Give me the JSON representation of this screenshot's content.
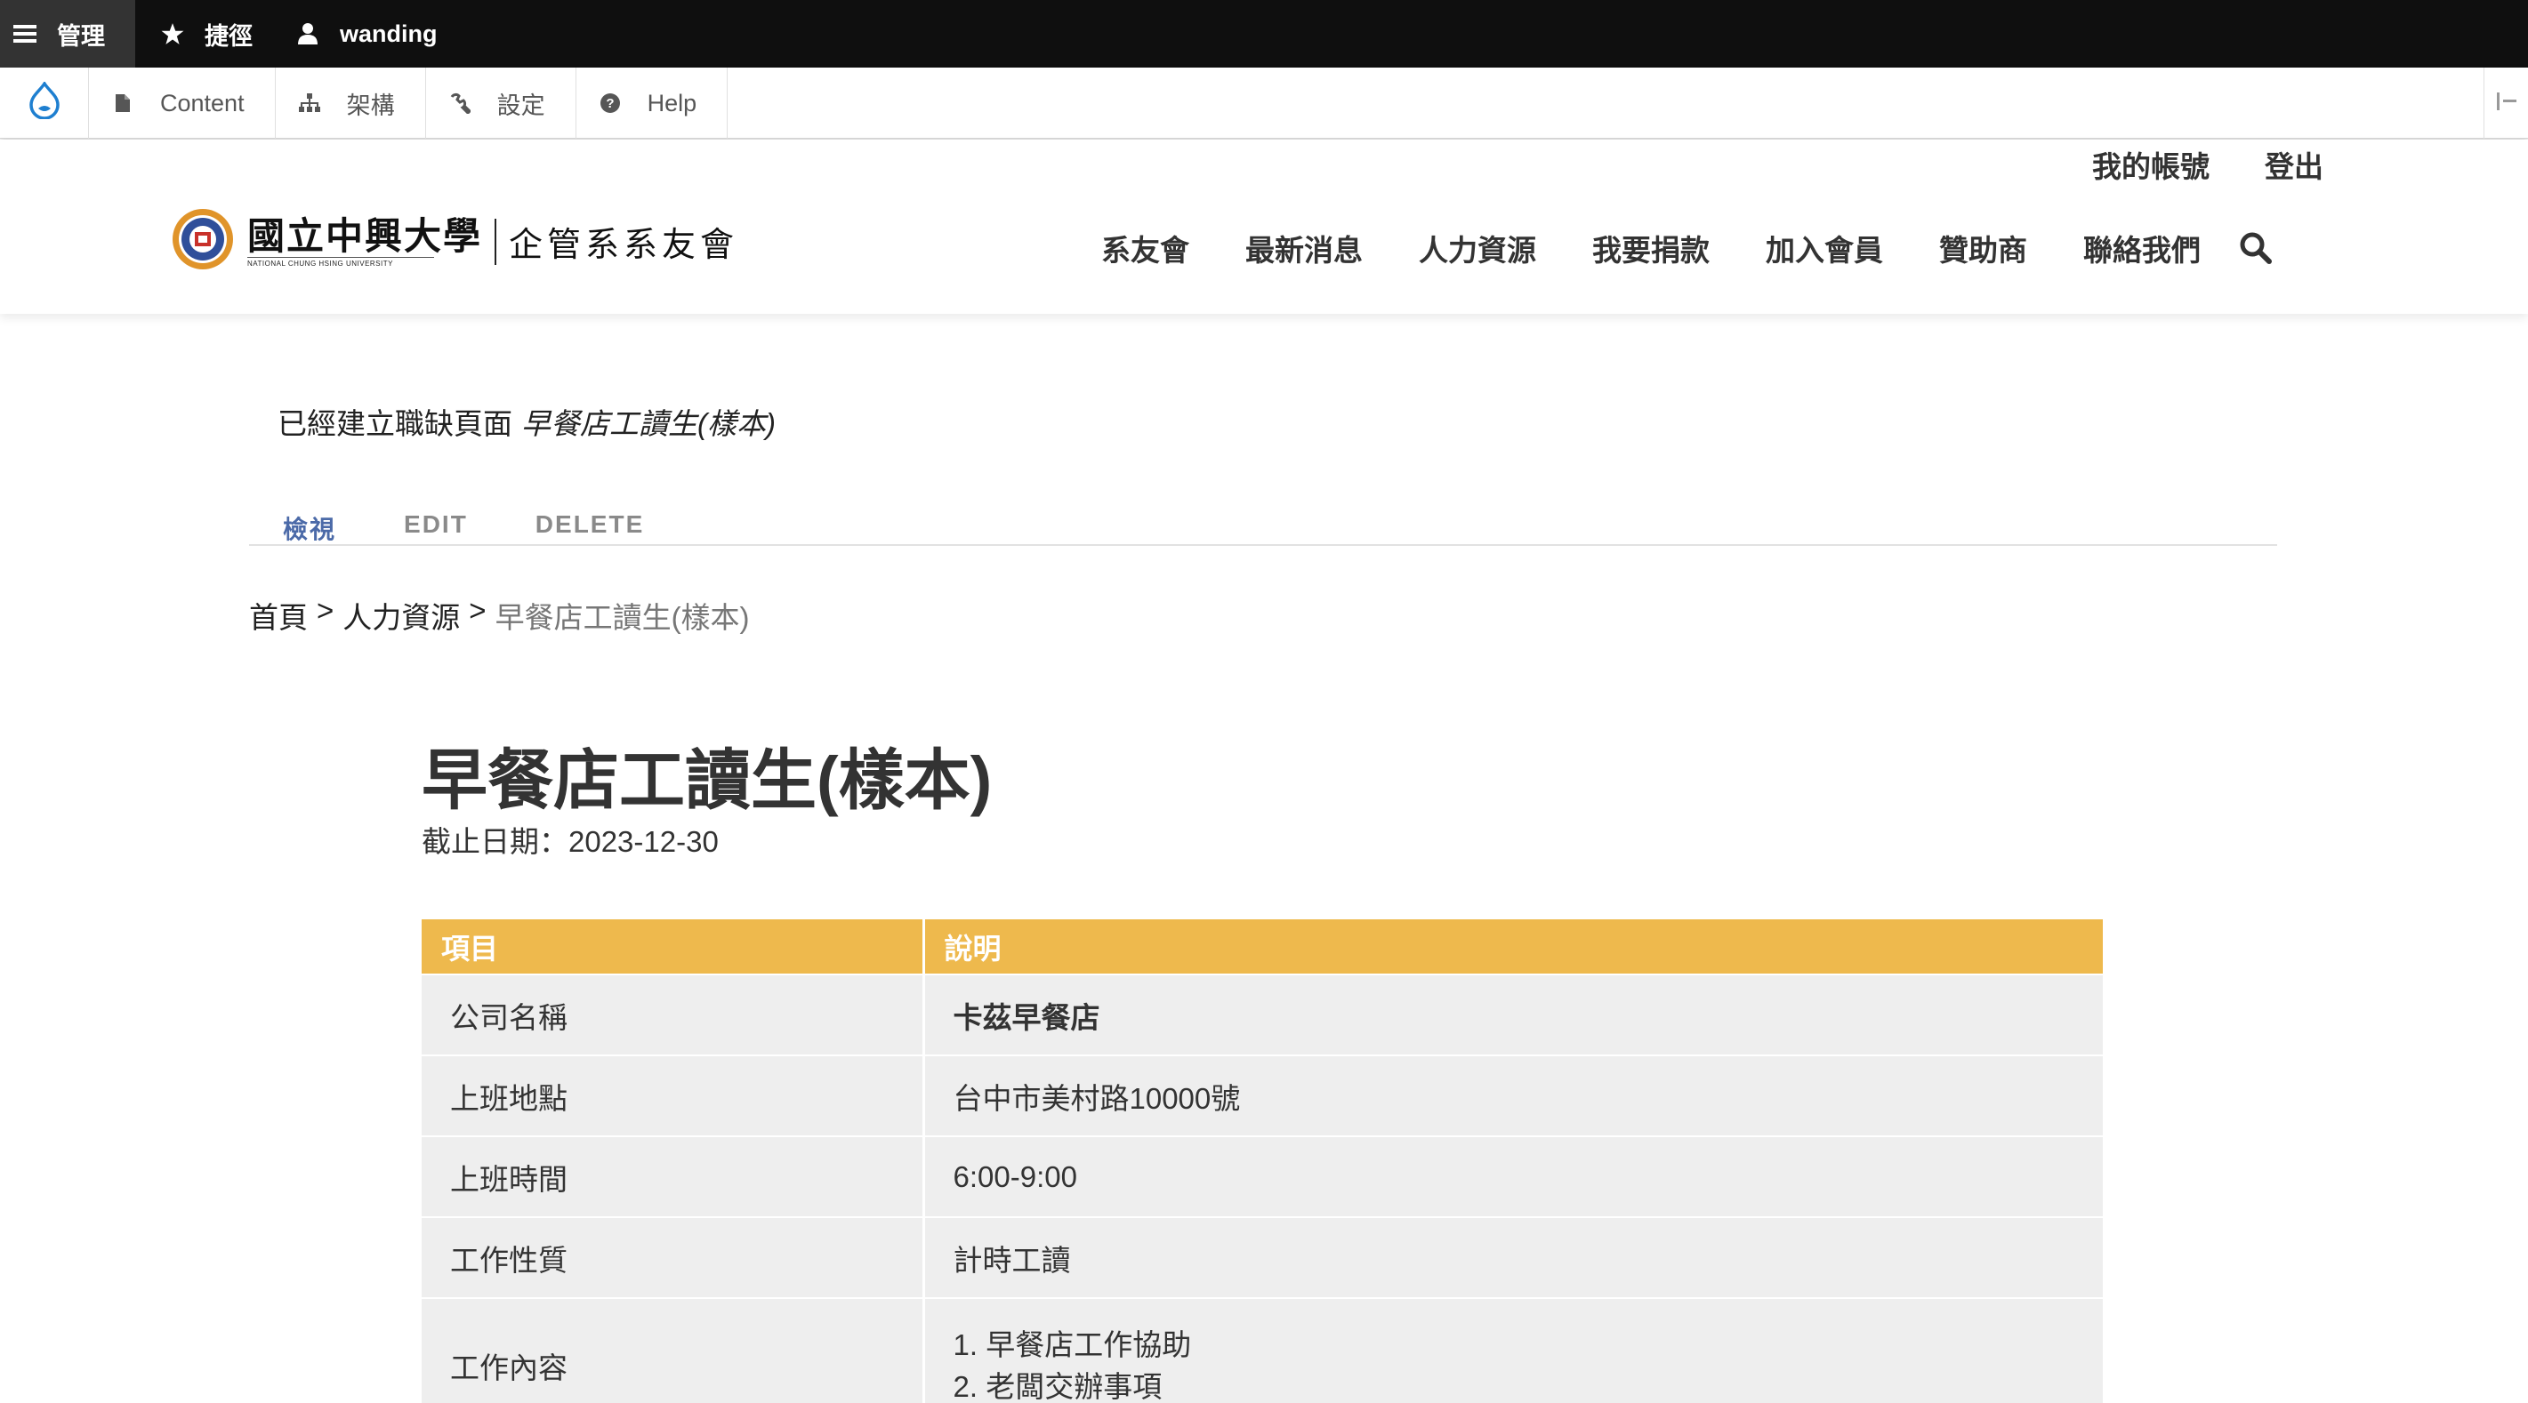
{
  "admin_toolbar": {
    "manage": "管理",
    "shortcuts": "捷徑",
    "user": "wanding"
  },
  "tray": {
    "items": [
      {
        "label": "Content",
        "icon": "file-icon"
      },
      {
        "label": "架構",
        "icon": "sitemap-icon"
      },
      {
        "label": "設定",
        "icon": "wrench-icon"
      },
      {
        "label": "Help",
        "icon": "help-icon"
      }
    ]
  },
  "header": {
    "user_links": [
      "我的帳號",
      "登出"
    ],
    "logo": {
      "university": "國立中興大學",
      "university_en": "NATIONAL CHUNG HSING UNIVERSITY",
      "department": "企管系系友會"
    },
    "nav": [
      "系友會",
      "最新消息",
      "人力資源",
      "我要捐款",
      "加入會員",
      "贊助商",
      "聯絡我們"
    ]
  },
  "status": {
    "text": "已經建立職缺頁面",
    "title": "早餐店工讀生(樣本)"
  },
  "tabs": [
    "檢視",
    "EDIT",
    "DELETE"
  ],
  "breadcrumb": {
    "home": "首頁",
    "section": "人力資源",
    "current": "早餐店工讀生(樣本)",
    "sep": ">"
  },
  "job": {
    "title": "早餐店工讀生(樣本)",
    "deadline_label": "截止日期：",
    "deadline": "2023-12-30",
    "table_headers": [
      "項目",
      "說明"
    ],
    "rows": [
      {
        "item": "公司名稱",
        "desc": "卡茲早餐店"
      },
      {
        "item": "上班地點",
        "desc": "台中市美村路10000號"
      },
      {
        "item": "上班時間",
        "desc": "6:00-9:00"
      },
      {
        "item": "工作性質",
        "desc": "計時工讀"
      }
    ],
    "duties_item": "工作內容",
    "duties": [
      "1. 早餐店工作協助",
      "2. 老闆交辦事項"
    ]
  }
}
